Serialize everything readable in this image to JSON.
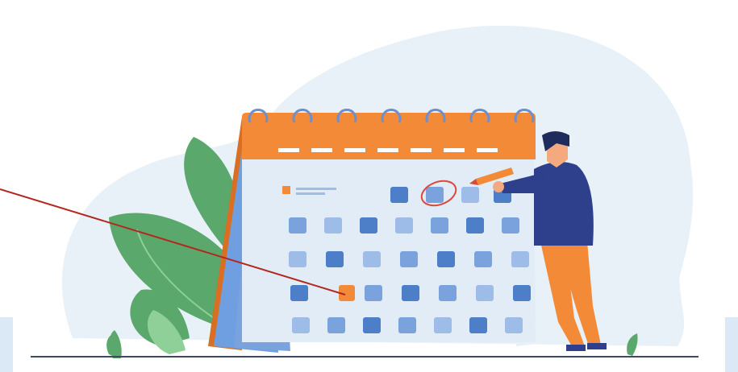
{
  "illustration": {
    "subject": "calendar-planning",
    "colors": {
      "blob": "#e9f1f8",
      "calendar_orange": "#f28a38",
      "calendar_orange_dark": "#d96f22",
      "calendar_side_blue": "#6f9fe0",
      "calendar_page": "#e1ecf7",
      "cell_light": "#9dbce8",
      "cell_mid": "#7aa3de",
      "cell_dark": "#4d7fc9",
      "ring": "#6d8fd0",
      "marked_cell": "#f28a38",
      "circle_mark": "#d94a3a",
      "leaf_green": "#5aa86c",
      "leaf_light": "#8fcf98",
      "person_shirt": "#2e3f8c",
      "person_pants": "#f28a38",
      "person_hair": "#1f2b5c",
      "skin": "#f5a97f",
      "pointer_line": "#b3271e",
      "ground": "#3f4a5e"
    },
    "elements": [
      "background-blob",
      "tropical-leaves",
      "desk-calendar",
      "spiral-rings",
      "date-grid",
      "highlighted-date",
      "circled-date",
      "person-with-pencil",
      "pointer-arrow",
      "ground-line"
    ]
  }
}
